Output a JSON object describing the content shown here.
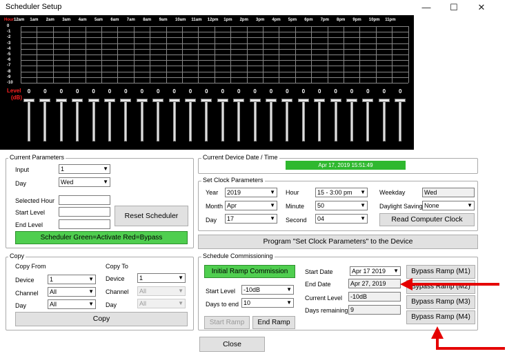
{
  "window": {
    "title": "Scheduler Setup",
    "min": "—",
    "max": "☐",
    "close": "✕"
  },
  "hours": [
    "Hour",
    "12am",
    "1am",
    "2am",
    "3am",
    "4am",
    "5am",
    "6am",
    "7am",
    "8am",
    "9am",
    "10am",
    "11am",
    "12pm",
    "1pm",
    "2pm",
    "3pm",
    "4pm",
    "5pm",
    "6pm",
    "7pm",
    "8pm",
    "9pm",
    "10pm",
    "11pm"
  ],
  "levels": [
    "0",
    "-1",
    "-2",
    "-3",
    "-4",
    "-5",
    "-6",
    "-7",
    "-8",
    "-9",
    "-10"
  ],
  "level_label": "Level",
  "db_label": "(dB)",
  "slot_values": [
    "0",
    "0",
    "0",
    "0",
    "0",
    "0",
    "0",
    "0",
    "0",
    "0",
    "0",
    "0",
    "0",
    "0",
    "0",
    "0",
    "0",
    "0",
    "0",
    "0",
    "0",
    "0",
    "0",
    "0"
  ],
  "current_params": {
    "title": "Current Parameters",
    "input_label": "Input",
    "input_value": "1",
    "day_label": "Day",
    "day_value": "Wed",
    "selected_hour_label": "Selected Hour",
    "start_level_label": "Start Level",
    "end_level_label": "End Level",
    "reset_button": "Reset Scheduler",
    "scheduler_button": "Scheduler  Green=Activate Red=Bypass"
  },
  "device_time": {
    "title": "Current Device Date / Time",
    "value": "Apr 17, 2019  15:51:49"
  },
  "clock": {
    "title": "Set Clock Parameters",
    "year_label": "Year",
    "year": "2019",
    "month_label": "Month",
    "month": "Apr",
    "day_label": "Day",
    "day": "17",
    "hour_label": "Hour",
    "hour": "15 - 3:00 pm",
    "minute_label": "Minute",
    "minute": "50",
    "second_label": "Second",
    "second": "04",
    "weekday_label": "Weekday",
    "weekday": "Wed",
    "dst_label": "Daylight Saving",
    "dst": "None",
    "read_button": "Read Computer Clock"
  },
  "program_button": "Program \"Set Clock Parameters\" to the Device",
  "copy": {
    "title": "Copy",
    "from_label": "Copy From",
    "to_label": "Copy To",
    "device_label": "Device",
    "channel_label": "Channel",
    "day_label": "Day",
    "from_device": "1",
    "from_channel": "All",
    "from_day": "All",
    "to_device": "1",
    "to_channel": "All",
    "to_day": "All",
    "button": "Copy"
  },
  "commission": {
    "title": "Schedule Commissioning",
    "initial_button": "Initial Ramp Commission",
    "start_level_label": "Start Level",
    "start_level": "-10dB",
    "days_to_end_label": "Days to end",
    "days_to_end": "10",
    "start_ramp": "Start Ramp",
    "end_ramp": "End Ramp",
    "start_date_label": "Start Date",
    "start_date": "Apr 17 2019",
    "end_date_label": "End Date",
    "end_date": "Apr 27, 2019",
    "current_level_label": "Current Level",
    "current_level": "-10dB",
    "days_remaining_label": "Days remaining",
    "days_remaining": "9",
    "bypass1": "Bypass Ramp (M1)",
    "bypass2": "Bypass Ramp (M2)",
    "bypass3": "Bypass Ramp (M3)",
    "bypass4": "Bypass Ramp (M4)"
  },
  "close_button": "Close",
  "colors": {
    "accent_green": "#4fce4f",
    "annotation_red": "#e50000"
  }
}
